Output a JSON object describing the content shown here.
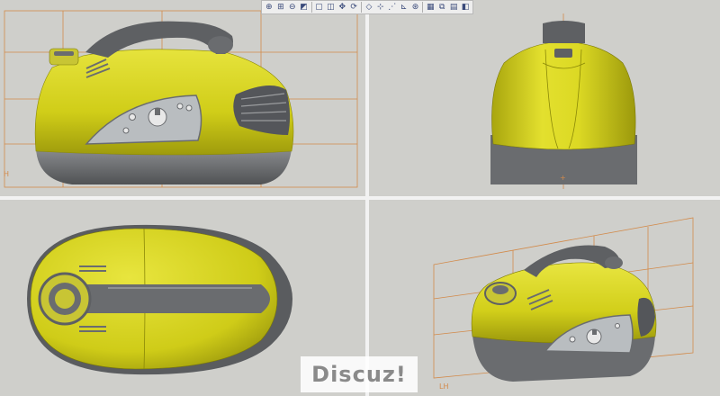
{
  "toolbar": {
    "buttons": [
      {
        "name": "zoom-in-icon",
        "glyph": "⊕"
      },
      {
        "name": "zoom-window-icon",
        "glyph": "⊞"
      },
      {
        "name": "zoom-out-icon",
        "glyph": "⊖"
      },
      {
        "name": "zoom-previous-icon",
        "glyph": "◩"
      },
      {
        "name": "fit-all-icon",
        "glyph": "▢"
      },
      {
        "name": "repaint-icon",
        "glyph": "◫"
      },
      {
        "name": "pan-icon",
        "glyph": "✥"
      },
      {
        "name": "rotate-icon",
        "glyph": "⟳"
      },
      {
        "name": "datum-planes-icon",
        "glyph": "◇"
      },
      {
        "name": "datum-axes-icon",
        "glyph": "⊹"
      },
      {
        "name": "point-display-icon",
        "glyph": "⋰"
      },
      {
        "name": "coordinate-system-icon",
        "glyph": "⊾"
      },
      {
        "name": "spin-center-icon",
        "glyph": "⊛"
      },
      {
        "name": "view-manager-icon",
        "glyph": "▦"
      },
      {
        "name": "named-view-icon",
        "glyph": "⧉"
      },
      {
        "name": "layer-icon",
        "glyph": "▤"
      },
      {
        "name": "shading-icon",
        "glyph": "◧"
      }
    ]
  },
  "colors": {
    "body_yellow": "#d4d11a",
    "body_shadow": "#9c9a10",
    "base_gray": "#6f7174",
    "handle_gray": "#5e6063",
    "panel_silver": "#b9bdc0",
    "datum_orange": "#d28a4a",
    "viewport_bg": "#cfcfcb"
  },
  "watermark": {
    "text": "Discuz!"
  },
  "viewports": {
    "top_left": {
      "view": "side"
    },
    "top_right": {
      "view": "front"
    },
    "bottom_left": {
      "view": "top"
    },
    "bottom_right": {
      "view": "isometric"
    }
  }
}
